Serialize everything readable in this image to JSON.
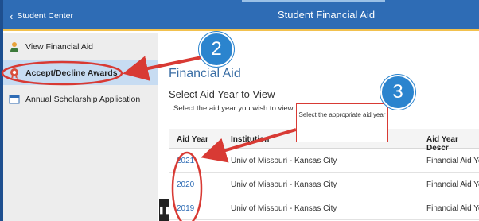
{
  "header": {
    "back_label": "Student Center",
    "title": "Student Financial Aid"
  },
  "sidebar": {
    "items": [
      {
        "label": "View Financial Aid",
        "icon": "person-icon",
        "active": false
      },
      {
        "label": "Accept/Decline Awards",
        "icon": "award-icon",
        "active": true
      },
      {
        "label": "Annual Scholarship Application",
        "icon": "window-icon",
        "active": false
      }
    ]
  },
  "main": {
    "section_title": "Financial Aid",
    "subtitle": "Select Aid Year to View",
    "instructions": "Select the aid year you wish to view",
    "table": {
      "columns": [
        "Aid Year",
        "Institution",
        "Aid Year Descr"
      ],
      "rows": [
        {
          "aid_year": "2021",
          "institution": "Univ of Missouri - Kansas City",
          "description": "Financial Aid Ye"
        },
        {
          "aid_year": "2020",
          "institution": "Univ of Missouri - Kansas City",
          "description": "Financial Aid Ye"
        },
        {
          "aid_year": "2019",
          "institution": "Univ of Missouri - Kansas City",
          "description": "Financial Aid Ye"
        }
      ]
    }
  },
  "annotations": {
    "step_two": "2",
    "step_three": "3",
    "callout_text": "Select the appropriate aid year"
  },
  "colors": {
    "header_bg": "#2e6cb5",
    "accent_gold": "#f2c14e",
    "step_circle": "#2b84ce",
    "annotation_red": "#d83a34",
    "link": "#2e6cb5"
  }
}
